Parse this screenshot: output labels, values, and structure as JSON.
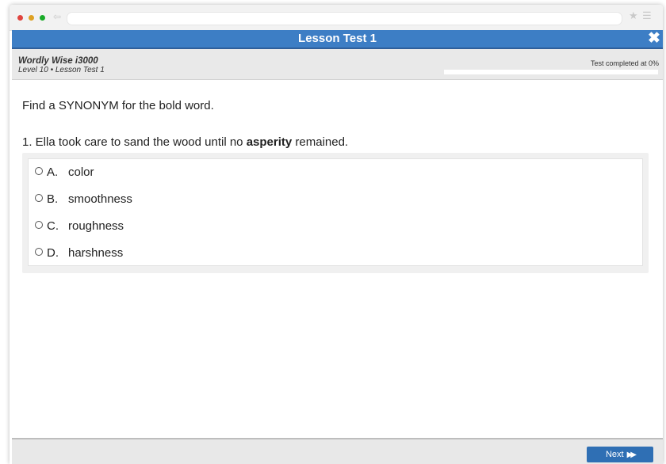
{
  "browser": {
    "back_icon": "back-arrow-icon",
    "star_icon": "star-icon",
    "menu_icon": "hamburger-menu-icon"
  },
  "titlebar": {
    "title": "Lesson Test 1",
    "close_icon": "close-icon",
    "color": "#3d7ec5"
  },
  "info": {
    "product": "Wordly Wise i3000",
    "level": "Level 10 • Lesson Test 1",
    "progress_label": "Test completed at 0%",
    "progress_fraction": 0
  },
  "question": {
    "instruction": "Find a SYNONYM for the bold word.",
    "prefix": "1. Ella took care to sand the wood until no ",
    "bold_word": "asperity",
    "suffix": " remained.",
    "choices": [
      {
        "letter": "A.",
        "text": "color"
      },
      {
        "letter": "B.",
        "text": "smoothness"
      },
      {
        "letter": "C.",
        "text": "roughness"
      },
      {
        "letter": "D.",
        "text": "harshness"
      }
    ]
  },
  "footer": {
    "next_label": "Next",
    "next_icon": "fast-forward-icon"
  }
}
